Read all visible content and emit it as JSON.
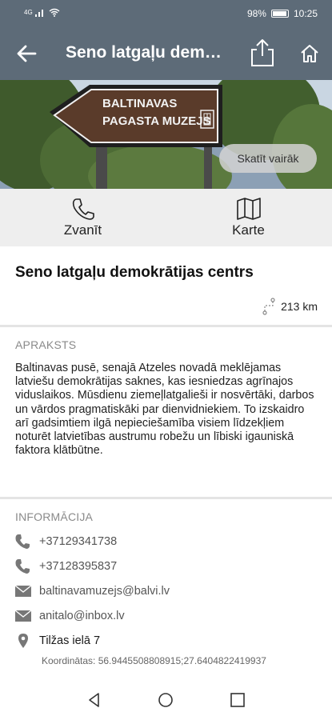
{
  "status_bar": {
    "network": "4G",
    "battery": "98%",
    "time": "10:25"
  },
  "app_bar": {
    "title": "Seno latgaļu demokrātijas centrs"
  },
  "hero": {
    "sign_text_line1": "BALTINAVAS",
    "sign_text_line2": "PAGASTA MUZEJS",
    "more_button": "Skatīt vairāk"
  },
  "actions": {
    "call_label": "Zvanīt",
    "map_label": "Karte"
  },
  "place": {
    "title": "Seno latgaļu demokrātijas centrs",
    "distance": "213 km"
  },
  "description": {
    "heading": "APRAKSTS",
    "text": "Baltinavas pusē, senajā Atzeles novadā meklējamas latviešu demokrātijas saknes, kas iesniedzas agrīnajos viduslaikos. Mūsdienu ziemeļlatgalieši ir nosvērtāki, darbos un vārdos pragmatiskāki par dienvidniekiem. To izskaidro arī gadsimtiem ilgā nepieciešamība visiem līdzekļiem noturēt latvietības austrumu robežu un lībiski igauniskā faktora klātbūtne."
  },
  "info": {
    "heading": "INFORMĀCIJA",
    "phone1": "+37129341738",
    "phone2": "+37128395837",
    "email1": "baltinavamuzejs@balvi.lv",
    "email2": "anitalo@inbox.lv",
    "address": "Tilžas ielā 7",
    "coordinates": "Koordinātas: 56.9445508808915;27.6404822419937"
  },
  "colors": {
    "app_bar": "#5d6b78",
    "action_bg": "#eeeeee",
    "sign": "#5a3b2a"
  }
}
